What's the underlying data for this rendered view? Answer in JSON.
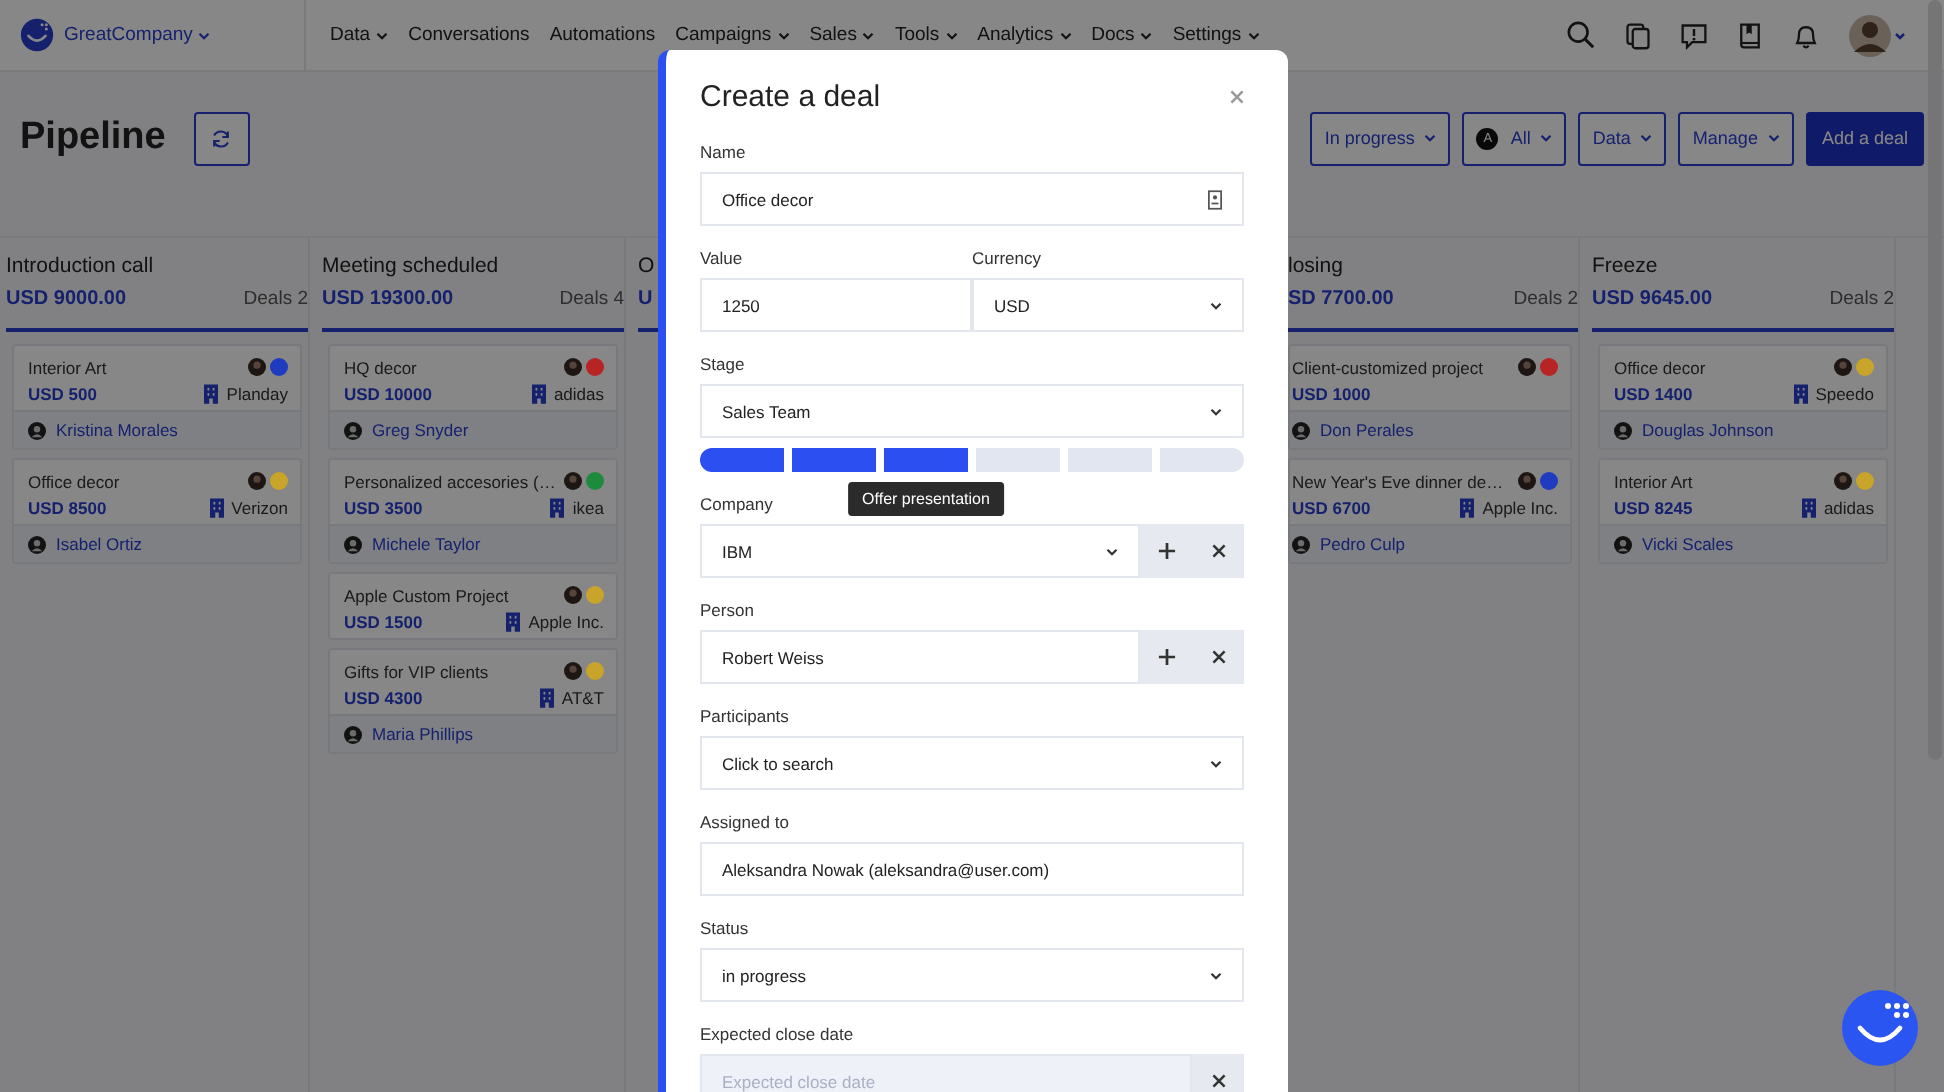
{
  "header": {
    "brand": "GreatCompany",
    "nav": [
      {
        "label": "Data",
        "dropdown": true
      },
      {
        "label": "Conversations",
        "dropdown": false
      },
      {
        "label": "Automations",
        "dropdown": false
      },
      {
        "label": "Campaigns",
        "dropdown": true
      },
      {
        "label": "Sales",
        "dropdown": true
      },
      {
        "label": "Tools",
        "dropdown": true
      },
      {
        "label": "Analytics",
        "dropdown": true
      },
      {
        "label": "Docs",
        "dropdown": true
      },
      {
        "label": "Settings",
        "dropdown": true
      }
    ]
  },
  "toolbar": {
    "title": "Pipeline",
    "filters": [
      {
        "label": "In progress",
        "kind": "dropdown"
      },
      {
        "label": "All",
        "kind": "owner",
        "badge": "A"
      },
      {
        "label": "Data",
        "kind": "dropdown"
      },
      {
        "label": "Manage",
        "kind": "dropdown"
      }
    ],
    "primary_button": "Add a deal"
  },
  "columns": [
    {
      "title": "Introduction call",
      "amount": "USD 9000.00",
      "count": "Deals 2",
      "cards": [
        {
          "title": "Interior Art",
          "amount": "USD 500",
          "company": "Planday",
          "contact": "Kristina Morales",
          "color": "#1f3bbf"
        },
        {
          "title": "Office decor",
          "amount": "USD 8500",
          "company": "Verizon",
          "contact": "Isabel Ortiz",
          "color": "#c9a42a"
        }
      ]
    },
    {
      "title": "Meeting scheduled",
      "amount": "USD 19300.00",
      "count": "Deals 4",
      "cards": [
        {
          "title": "HQ decor",
          "amount": "USD 10000",
          "company": "adidas",
          "contact": "Greg Snyder",
          "color": "#b82424"
        },
        {
          "title": "Personalized accesories (…",
          "amount": "USD 3500",
          "company": "ikea",
          "contact": "Michele Taylor",
          "color": "#1e8a3e"
        },
        {
          "title": "Apple Custom Project",
          "amount": "USD 1500",
          "company": "Apple Inc.",
          "color": "#c9a42a"
        },
        {
          "title": "Gifts for VIP clients",
          "amount": "USD 4300",
          "company": "AT&T",
          "contact": "Maria Phillips",
          "color": "#c9a42a"
        }
      ]
    },
    {
      "title": "O",
      "amount": "U",
      "kind": "covered"
    },
    {
      "kind": "hidden"
    },
    {
      "title": "losing",
      "amount": "SD 7700.00",
      "count": "Deals 2",
      "kind": "edge",
      "cards": [
        {
          "title": "Client-customized project",
          "amount": "USD 1000",
          "contact": "Don Perales",
          "color": "#b82424"
        },
        {
          "title": "New Year's Eve dinner de…",
          "amount": "USD 6700",
          "company": "Apple Inc.",
          "contact": "Pedro Culp",
          "color": "#1f3bbf"
        }
      ]
    },
    {
      "title": "Freeze",
      "amount": "USD 9645.00",
      "count": "Deals 2",
      "cards": [
        {
          "title": "Office decor",
          "amount": "USD 1400",
          "company": "Speedo",
          "contact": "Douglas Johnson",
          "color": "#c9a42a"
        },
        {
          "title": "Interior Art",
          "amount": "USD 8245",
          "company": "adidas",
          "contact": "Vicki Scales",
          "color": "#c9a42a"
        }
      ]
    }
  ],
  "modal": {
    "title": "Create a deal",
    "rows": [
      [
        {
          "label": "Name",
          "kind": "text",
          "value": "Office decor",
          "icon": true
        }
      ],
      [
        {
          "label": "Value",
          "kind": "text",
          "value": "1250"
        },
        {
          "label": "Currency",
          "kind": "select",
          "value": "USD"
        }
      ],
      [
        {
          "label": "Stage",
          "kind": "stage",
          "value": "Sales Team",
          "steps": [
            {
              "done": true
            },
            {
              "done": true
            },
            {
              "done": true,
              "tooltip": "Offer presentation"
            },
            {
              "done": false
            },
            {
              "done": false
            },
            {
              "done": false
            }
          ]
        }
      ],
      [
        {
          "label": "Company",
          "kind": "select-actions",
          "value": "IBM"
        }
      ],
      [
        {
          "label": "Person",
          "kind": "text-actions",
          "value": "Robert Weiss"
        }
      ],
      [
        {
          "label": "Participants",
          "kind": "select",
          "value": "Click to search"
        }
      ],
      [
        {
          "label": "Assigned to",
          "kind": "text",
          "value": "Aleksandra Nowak (aleksandra@user.com)"
        }
      ],
      [
        {
          "label": "Status",
          "kind": "select",
          "value": "in progress"
        }
      ],
      [
        {
          "label": "Expected close date",
          "kind": "date",
          "placeholder": "Expected close date"
        }
      ]
    ]
  }
}
